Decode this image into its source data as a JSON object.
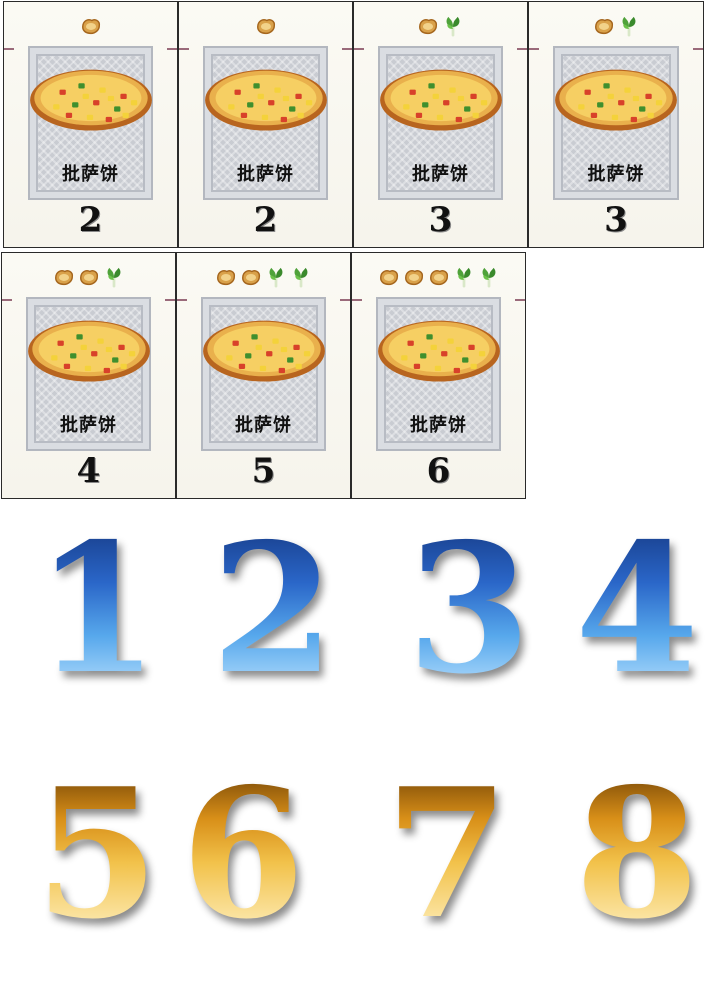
{
  "watermark": "",
  "colors": {
    "bread": "#d9a14a",
    "bread_crust": "#a5661d",
    "veg": "#4fa23a",
    "number_blue": "#2a66c8",
    "number_gold": "#e0a02a"
  },
  "cards": [
    {
      "name": "批萨饼",
      "number": "2",
      "bread": 1,
      "veg": 0
    },
    {
      "name": "批萨饼",
      "number": "2",
      "bread": 1,
      "veg": 0
    },
    {
      "name": "批萨饼",
      "number": "3",
      "bread": 1,
      "veg": 1
    },
    {
      "name": "批萨饼",
      "number": "3",
      "bread": 1,
      "veg": 1
    },
    {
      "name": "批萨饼",
      "number": "4",
      "bread": 2,
      "veg": 1
    },
    {
      "name": "批萨饼",
      "number": "5",
      "bread": 2,
      "veg": 2
    },
    {
      "name": "批萨饼",
      "number": "6",
      "bread": 3,
      "veg": 2
    }
  ],
  "number_tiles": [
    {
      "value": "1",
      "style": "blue"
    },
    {
      "value": "2",
      "style": "blue"
    },
    {
      "value": "3",
      "style": "blue"
    },
    {
      "value": "4",
      "style": "blue"
    },
    {
      "value": "5",
      "style": "gold"
    },
    {
      "value": "6",
      "style": "gold"
    },
    {
      "value": "7",
      "style": "gold"
    },
    {
      "value": "8",
      "style": "gold"
    }
  ]
}
